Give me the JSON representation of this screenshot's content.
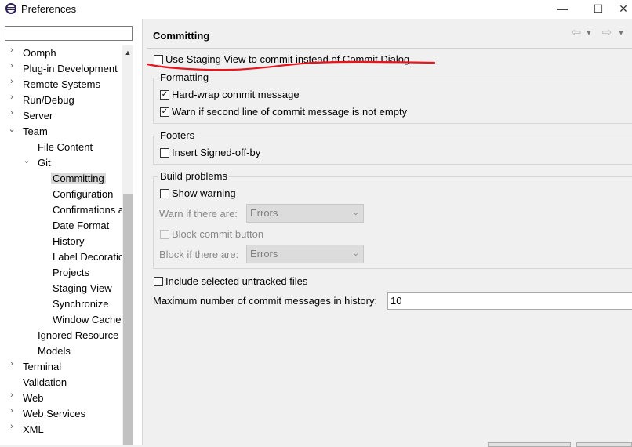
{
  "window": {
    "title": "Preferences",
    "minimize": "—",
    "maximize": "☐",
    "close": "✕"
  },
  "filter": {
    "value": "",
    "placeholder": ""
  },
  "tree": [
    {
      "label": "Oomph",
      "twisty": "›"
    },
    {
      "label": "Plug-in Development",
      "twisty": "›"
    },
    {
      "label": "Remote Systems",
      "twisty": "›"
    },
    {
      "label": "Run/Debug",
      "twisty": "›"
    },
    {
      "label": "Server",
      "twisty": "›"
    },
    {
      "label": "Team",
      "twisty": "⌄"
    },
    {
      "label": "File Content",
      "twisty": ""
    },
    {
      "label": "Git",
      "twisty": "⌄"
    },
    {
      "label": "Committing",
      "twisty": ""
    },
    {
      "label": "Configuration",
      "twisty": ""
    },
    {
      "label": "Confirmations a",
      "twisty": ""
    },
    {
      "label": "Date Format",
      "twisty": ""
    },
    {
      "label": "History",
      "twisty": ""
    },
    {
      "label": "Label Decoratio",
      "twisty": ""
    },
    {
      "label": "Projects",
      "twisty": ""
    },
    {
      "label": "Staging View",
      "twisty": ""
    },
    {
      "label": "Synchronize",
      "twisty": ""
    },
    {
      "label": "Window Cache",
      "twisty": ""
    },
    {
      "label": "Ignored Resource",
      "twisty": ""
    },
    {
      "label": "Models",
      "twisty": ""
    },
    {
      "label": "Terminal",
      "twisty": "›"
    },
    {
      "label": "Validation",
      "twisty": ""
    },
    {
      "label": "Web",
      "twisty": "›"
    },
    {
      "label": "Web Services",
      "twisty": "›"
    },
    {
      "label": "XML",
      "twisty": "›"
    }
  ],
  "page": {
    "title": "Committing",
    "nav": {
      "back": "⇦",
      "back_menu": "▾",
      "forward": "⇨",
      "forward_menu": "▾"
    },
    "use_staging": {
      "label": "Use Staging View to commit instead of Commit Dialog",
      "checked": false
    },
    "formatting": {
      "title": "Formatting",
      "hard_wrap": {
        "label": "Hard-wrap commit message",
        "checked": true
      },
      "warn_second_line": {
        "label": "Warn if second line of commit message is not empty",
        "checked": true
      }
    },
    "footers": {
      "title": "Footers",
      "signed_off": {
        "label": "Insert Signed-off-by",
        "checked": false
      }
    },
    "build_problems": {
      "title": "Build problems",
      "show_warning": {
        "label": "Show warning",
        "checked": false
      },
      "warn_if_label": "Warn if there are:",
      "warn_if_value": "Errors",
      "block_commit": {
        "label": "Block commit button",
        "checked": false
      },
      "block_if_label": "Block if there are:",
      "block_if_value": "Errors"
    },
    "include_untracked": {
      "label": "Include selected untracked files",
      "checked": false
    },
    "max_messages": {
      "label": "Maximum number of commit messages in history:",
      "value": "10"
    }
  },
  "colors": {
    "annotation": "#e8141e",
    "selection": "#d9d9d9"
  },
  "icons": {
    "app": "eclipse-icon",
    "check": "✓"
  }
}
